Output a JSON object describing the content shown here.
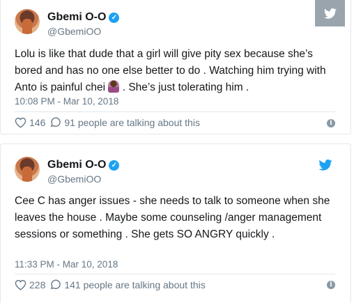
{
  "tweets": [
    {
      "name": "Gbemi O-O",
      "handle": "@GbemiOO",
      "text": "Lolu is like that dude that a girl will give pity sex because she’s bored and has no one else better to do . Watching him trying with Anto is painful chei",
      "text_after_emoji": ". She’s just tolerating him .",
      "emoji": "woman-facepalming",
      "time": "10:08 PM - Mar 10, 2018",
      "likes": "146",
      "talking": "91 people are talking about this"
    },
    {
      "name": "Gbemi O-O",
      "handle": "@GbemiOO",
      "text": "Cee C has anger issues - she needs to talk to someone when she leaves the house . Maybe some counseling /anger management sessions or something . She gets SO ANGRY quickly .",
      "time": "11:33 PM - Mar 10, 2018",
      "likes": "228",
      "talking": "141 people are talking about this"
    }
  ],
  "icons": {
    "verified": "verified-badge-icon",
    "bird": "twitter-bird-icon",
    "heart": "heart-icon",
    "comment": "comment-icon",
    "info": "info-icon"
  },
  "colors": {
    "accent": "#1da1f2",
    "muted": "#657786",
    "border": "#e1e8ed"
  }
}
